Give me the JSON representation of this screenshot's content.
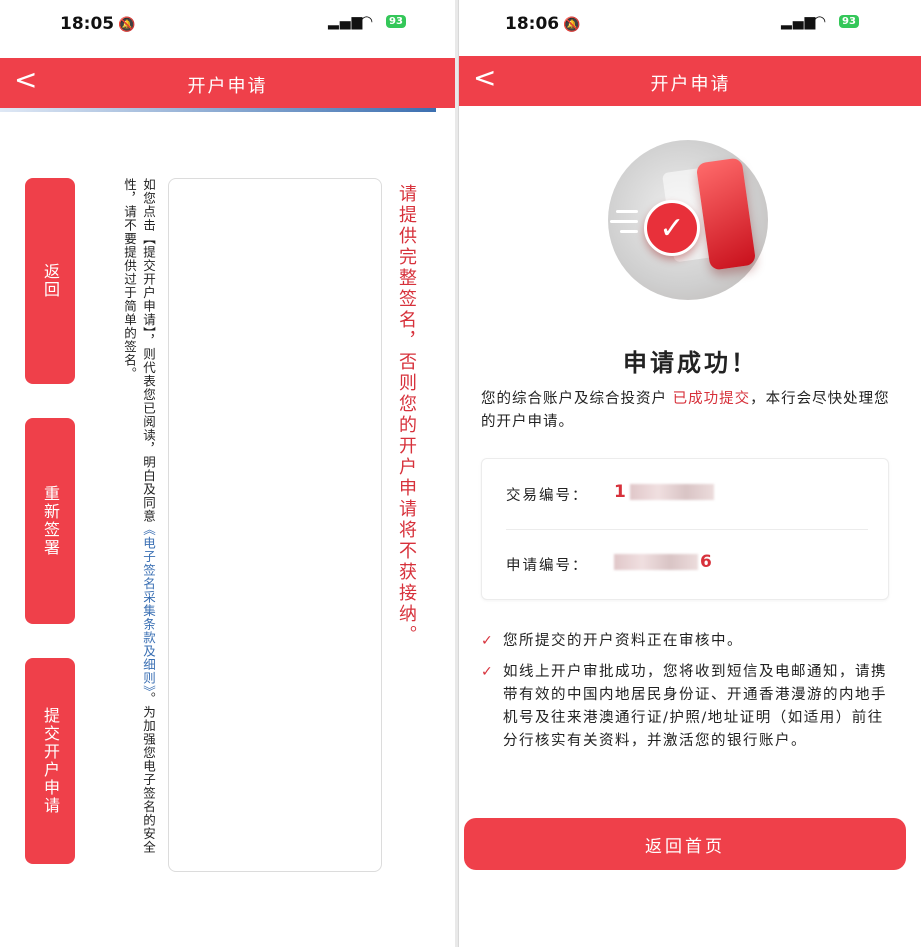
{
  "left": {
    "status": {
      "time": "18:05",
      "battery": "93"
    },
    "nav": {
      "back": "<",
      "title": "开户申请"
    },
    "buttons": {
      "return": "返回",
      "resign": "重新签署",
      "submit": "提交开户申请"
    },
    "notice_pre": "如您点击【提交开户申请】，则代表您已阅读，明白及同意",
    "notice_link": "《电子签名采集条款及细则》",
    "notice_post": "。为加强您电子签名的安全性，请不要提供过于简单的签名。",
    "warning": "请提供完整签名，否则您的开户申请将不获接纳。"
  },
  "right": {
    "status": {
      "time": "18:06",
      "battery": "93"
    },
    "nav": {
      "back": "<",
      "title": "开户申请"
    },
    "success_title": "申请成功！",
    "desc_pre": "您的综合账户及综合投资户 ",
    "desc_highlight": "已成功提交",
    "desc_post": "，本行会尽快处理您的开户申请。",
    "transaction_label": "交易编号：",
    "transaction_value": "1",
    "application_label": "申请编号：",
    "application_value": "6",
    "bullets": [
      "您所提交的开户资料正在审核中。",
      "如线上开户审批成功，您将收到短信及电邮通知，请携带有效的中国内地居民身份证、开通香港漫游的内地手机号及往来港澳通行证/护照/地址证明（如适用）前往分行核实有关资料，并激活您的银行账户。"
    ],
    "home_button": "返回首页"
  },
  "colors": {
    "brand_red": "#ef404a",
    "highlight_red": "#d7313b",
    "link_blue": "#3a6fb3"
  },
  "icons": {
    "back": "chevron-left-icon",
    "check": "check-icon",
    "silent": "bell-slash-icon"
  }
}
